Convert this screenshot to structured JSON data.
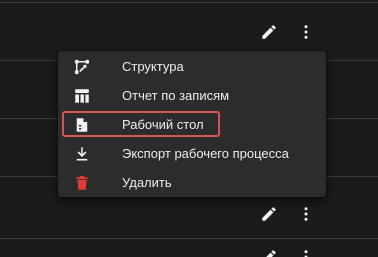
{
  "menu": {
    "items": [
      {
        "label": "Структура",
        "icon": "structure-icon"
      },
      {
        "label": "Отчет по записям",
        "icon": "table-icon"
      },
      {
        "label": "Рабочий стол",
        "icon": "document-icon",
        "highlighted": true
      },
      {
        "label": "Экспорт рабочего процесса",
        "icon": "download-icon"
      },
      {
        "label": "Удалить",
        "icon": "trash-icon"
      }
    ]
  },
  "colors": {
    "background": "#1b1b1b",
    "menu_background": "#2c2c2c",
    "text": "#ececec",
    "icon": "#f2f2f2",
    "delete_icon": "#e53935",
    "highlight_border": "#d9534f",
    "row_divider": "#3a3a3a"
  }
}
